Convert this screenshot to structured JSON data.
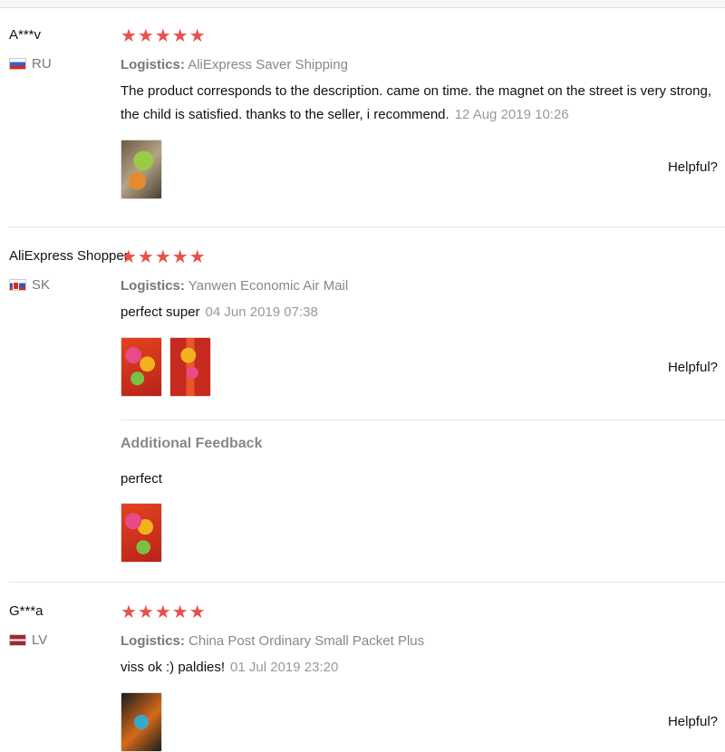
{
  "helpful_label": "Helpful?",
  "logistics_label": "Logistics:",
  "star_glyphs": "★★★★★",
  "colors": {
    "star": "#e8514c",
    "muted": "#888888"
  },
  "reviews": [
    {
      "user": "A***v",
      "country": "RU",
      "rating": 5,
      "logistics": "AliExpress Saver Shipping",
      "comment": "The product corresponds to the description. came on time. the magnet on the street is very strong, the child is satisfied. thanks to the seller, i recommend.",
      "date": "12 Aug 2019 10:26",
      "photo_count": 1
    },
    {
      "user": "AliExpress Shopper",
      "country": "SK",
      "rating": 5,
      "logistics": "Yanwen Economic Air Mail",
      "comment": "perfect super",
      "date": "04 Jun 2019 07:38",
      "photo_count": 2,
      "additional_feedback": {
        "title": "Additional Feedback",
        "text": "perfect",
        "photo_count": 1
      }
    },
    {
      "user": "G***a",
      "country": "LV",
      "rating": 5,
      "logistics": "China Post Ordinary Small Packet Plus",
      "comment": "viss ok :) paldies!",
      "date": "01 Jul 2019 23:20",
      "photo_count": 1
    }
  ]
}
